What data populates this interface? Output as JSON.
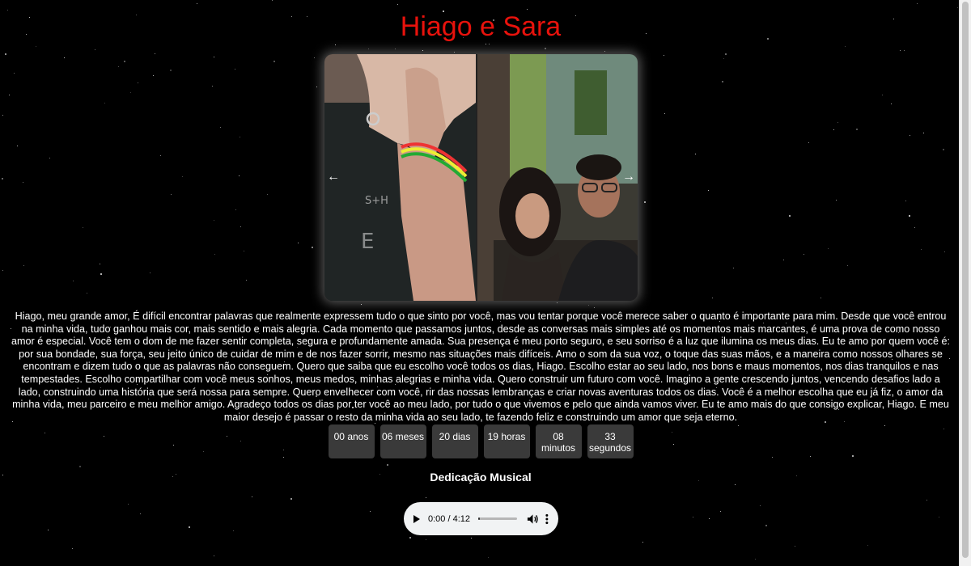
{
  "title": "Hiago e Sara",
  "carousel": {
    "prev_label": "←",
    "next_label": "→"
  },
  "message": "Hiago, meu grande amor, É difícil encontrar palavras que realmente expressem tudo o que sinto por você, mas vou tentar porque você merece saber o quanto é importante para mim. Desde que você entrou na minha vida, tudo ganhou mais cor, mais sentido e mais alegria. Cada momento que passamos juntos, desde as conversas mais simples até os momentos mais marcantes, é uma prova de como nosso amor é especial. Você tem o dom de me fazer sentir completa, segura e profundamente amada. Sua presença é meu porto seguro, e seu sorriso é a luz que ilumina os meus dias. Eu te amo por quem você é: por sua bondade, sua força, seu jeito único de cuidar de mim e de nos fazer sorrir, mesmo nas situações mais difíceis. Amo o som da sua voz, o toque das suas mãos, e a maneira como nossos olhares se encontram e dizem tudo o que as palavras não conseguem. Quero que saiba que eu escolho você todos os dias, Hiago. Escolho estar ao seu lado, nos bons e maus momentos, nos dias tranquilos e nas tempestades. Escolho compartilhar com você meus sonhos, meus medos, minhas alegrias e minha vida. Quero construir um futuro com você. Imagino a gente crescendo juntos, vencendo desafios lado a lado, construindo uma história que será nossa para sempre. Quero envelhecer com você, rir das nossas lembranças e criar novas aventuras todos os dias. Você é a melhor escolha que eu já fiz, o amor da minha vida, meu parceiro e meu melhor amigo. Agradeço todos os dias por ter você ao meu lado, por tudo o que vivemos e pelo que ainda vamos viver. Eu te amo mais do que consigo explicar, Hiago. E meu maior desejo é passar o resto da minha vida ao seu lado, te fazendo feliz e construindo um amor que seja eterno.",
  "countdown": [
    {
      "value": "00",
      "unit": "anos"
    },
    {
      "value": "06",
      "unit": "meses"
    },
    {
      "value": "20",
      "unit": "dias"
    },
    {
      "value": "19",
      "unit": "horas"
    },
    {
      "value": "08",
      "unit": "minutos"
    },
    {
      "value": "33",
      "unit": "segundos"
    }
  ],
  "music": {
    "heading": "Dedicação Musical",
    "time_display": "0:00 / 4:12",
    "progress": 0.04
  },
  "colors": {
    "title": "#e8120c",
    "background": "#000000",
    "count_box": "#3a3a3a",
    "player_bg": "#f1f3f4"
  }
}
